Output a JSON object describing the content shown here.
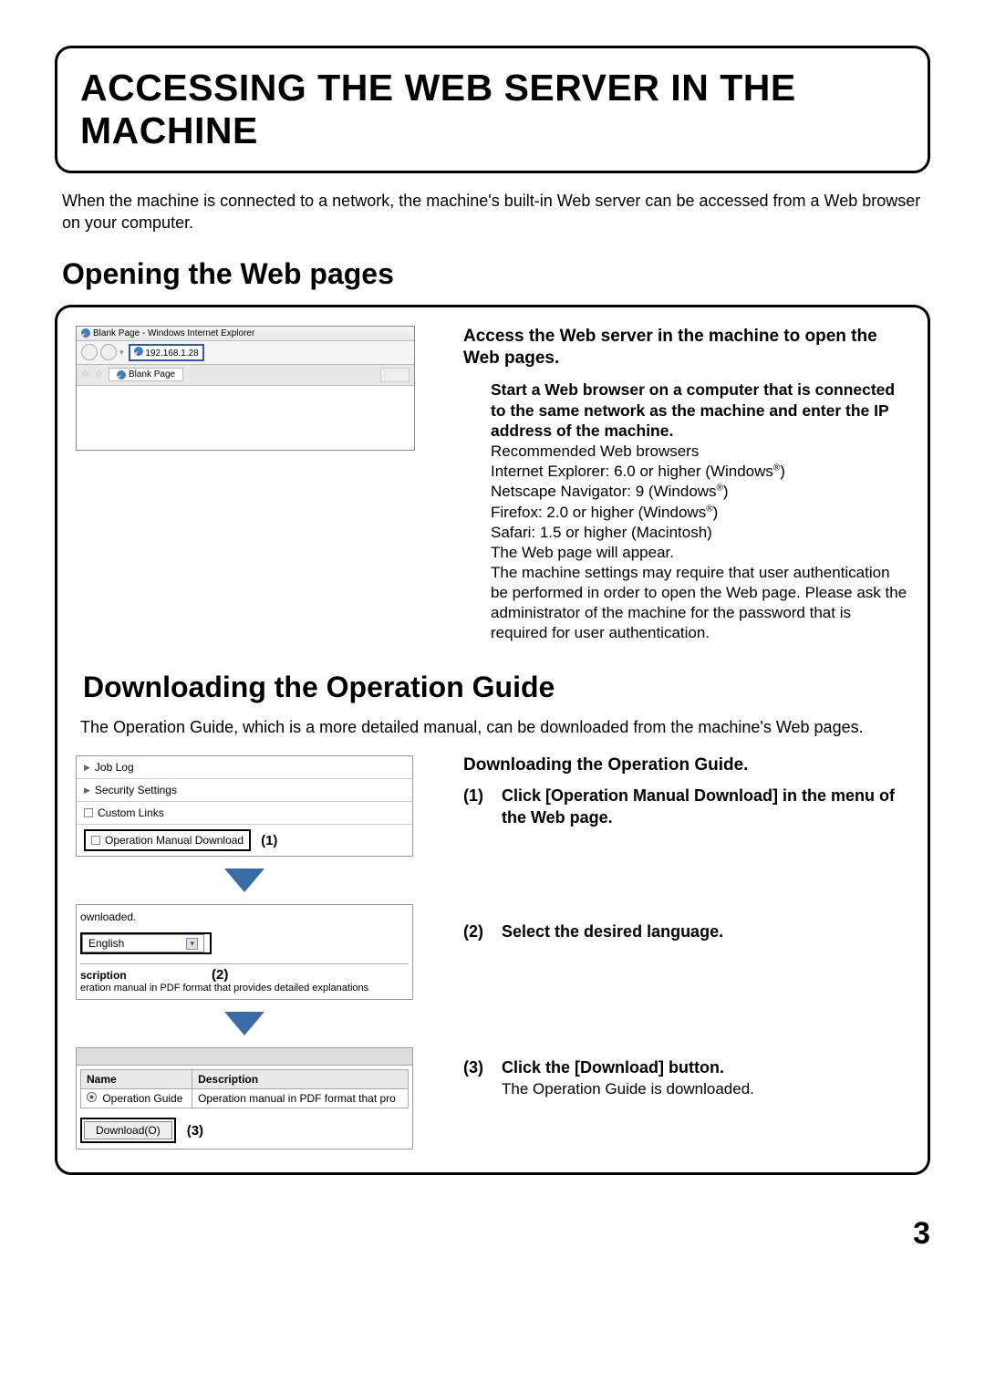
{
  "title": "ACCESSING THE WEB SERVER IN THE MACHINE",
  "intro": "When the machine is connected to a network, the machine's built-in Web server can be accessed from a Web browser on your computer.",
  "section1": {
    "heading": "Opening the Web pages",
    "browser": {
      "title_prefix": "Blank Page - Windows Internet Explorer",
      "url": "192.168.1.28",
      "tab": "Blank Page"
    },
    "access_heading": "Access the Web server in the machine to open the Web pages.",
    "start_heading": "Start a Web browser on a computer that is connected to the same network as the machine and enter the IP address of the machine.",
    "rec_label": "Recommended Web browsers",
    "ie": "Internet Explorer: 6.0 or higher (Windows",
    "netscape": "Netscape Navigator: 9 (Windows",
    "firefox": "Firefox: 2.0 or higher (Windows",
    "safari": "Safari: 1.5 or higher (Macintosh)",
    "appear": "The Web page will appear.",
    "auth": "The machine settings may require that user authentication be performed in order to open the Web page. Please ask the administrator of the machine for the password that is required for user authentication."
  },
  "section2": {
    "heading": "Downloading the Operation Guide",
    "intro": "The Operation Guide, which is a more detailed manual, can be downloaded from the machine's Web pages.",
    "menu": {
      "job_log": "Job Log",
      "security": "Security Settings",
      "custom": "Custom Links",
      "download": "Operation Manual Download"
    },
    "panel2": {
      "ownloaded": "ownloaded.",
      "lang": "English",
      "scription": "scription",
      "desc": "eration manual in PDF format that provides detailed explanations"
    },
    "table": {
      "name_h": "Name",
      "desc_h": "Description",
      "row_name": "Operation Guide",
      "row_desc": "Operation manual in PDF format that pro",
      "btn": "Download(O)"
    },
    "right_heading": "Downloading the Operation Guide.",
    "steps": [
      {
        "num": "(1)",
        "text": "Click [Operation Manual Download] in the menu of the Web page."
      },
      {
        "num": "(2)",
        "text": "Select the desired language."
      },
      {
        "num": "(3)",
        "text": "Click the [Download] button.",
        "note": "The Operation Guide is downloaded."
      }
    ],
    "callouts": {
      "c1": "(1)",
      "c2": "(2)",
      "c3": "(3)"
    }
  },
  "page_number": "3",
  "reg": "®"
}
